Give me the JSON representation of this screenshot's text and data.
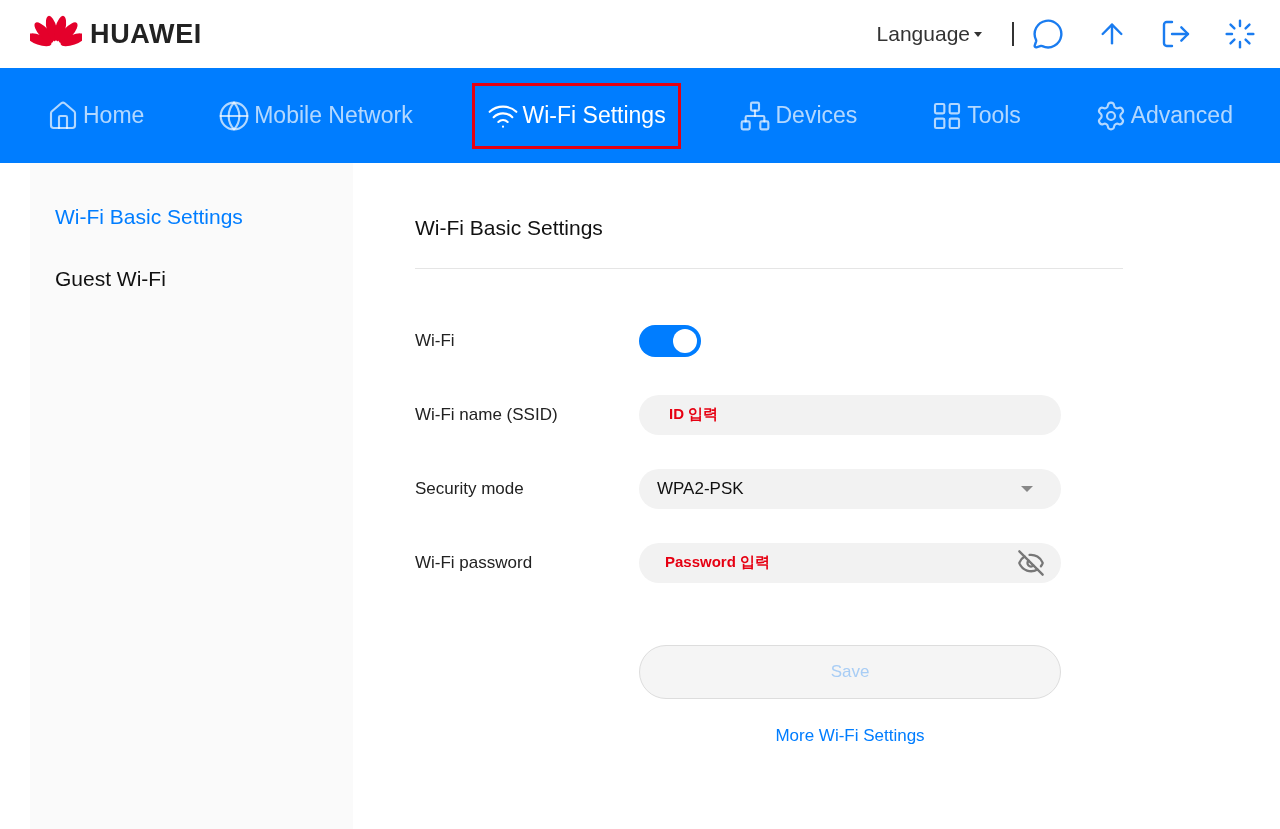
{
  "header": {
    "brand": "HUAWEI",
    "language": "Language"
  },
  "nav": [
    {
      "label": "Home",
      "selected": false,
      "highlighted": false
    },
    {
      "label": "Mobile Network",
      "selected": false,
      "highlighted": false
    },
    {
      "label": "Wi-Fi Settings",
      "selected": true,
      "highlighted": true
    },
    {
      "label": "Devices",
      "selected": false,
      "highlighted": false
    },
    {
      "label": "Tools",
      "selected": false,
      "highlighted": false
    },
    {
      "label": "Advanced",
      "selected": false,
      "highlighted": false
    }
  ],
  "sidebar": {
    "items": [
      {
        "label": "Wi-Fi Basic Settings",
        "selected": true
      },
      {
        "label": "Guest Wi-Fi",
        "selected": false
      }
    ]
  },
  "content": {
    "title": "Wi-Fi Basic Settings",
    "wifi": {
      "label": "Wi-Fi",
      "on": true
    },
    "ssid": {
      "label": "Wi-Fi name (SSID)",
      "value": "ID 입력"
    },
    "security": {
      "label": "Security mode",
      "value": "WPA2-PSK"
    },
    "password": {
      "label": "Wi-Fi password",
      "value": "Password 입력",
      "visible": false
    },
    "save": {
      "label": "Save",
      "disabled": true
    },
    "more_link": "More Wi-Fi Settings"
  }
}
